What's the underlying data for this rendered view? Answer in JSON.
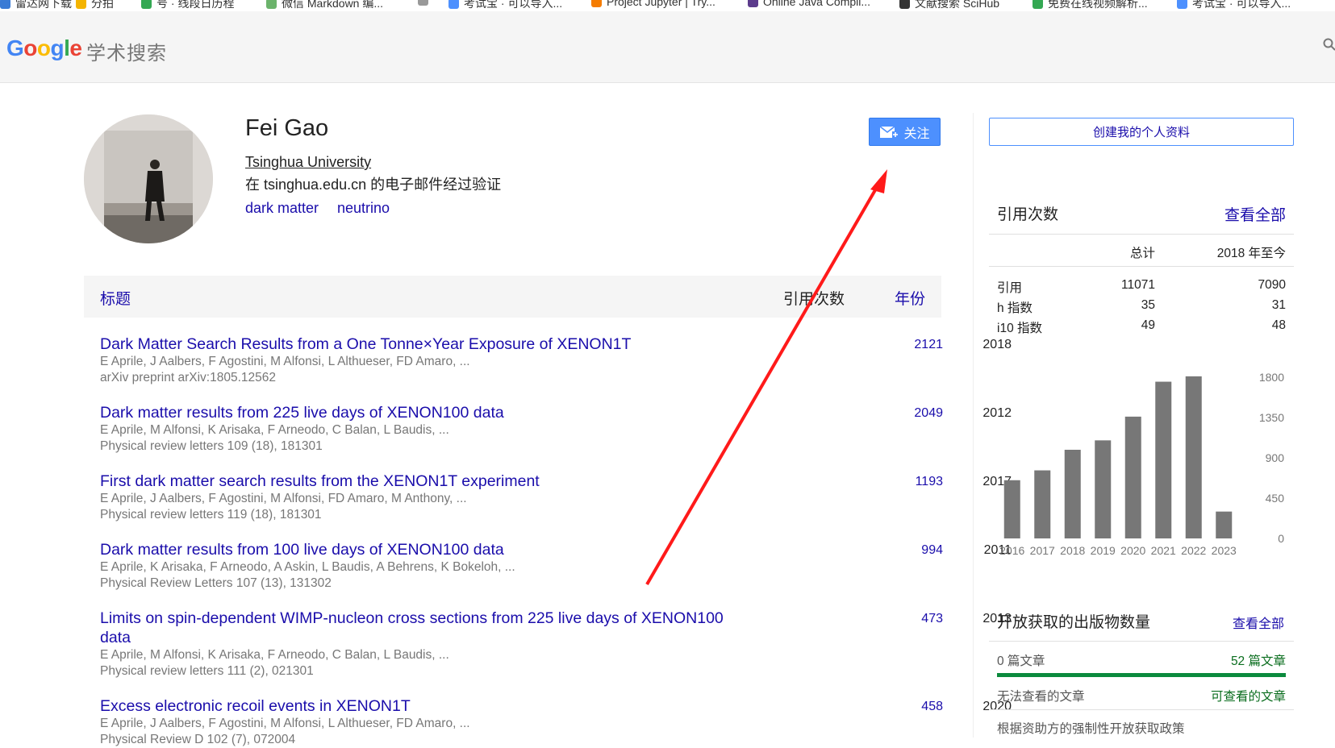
{
  "bookmarks": [
    {
      "label": "雷达网下载",
      "color": "#3a7bd5"
    },
    {
      "label": "分拍",
      "color": "#f4b400"
    },
    {
      "label": "号 · 线段日历程",
      "color": "#34a853"
    },
    {
      "label": "微信 Markdown 编...",
      "color": "#6bb36b"
    },
    {
      "label": "",
      "color": "#999999"
    },
    {
      "label": "考试宝 · 可以导入...",
      "color": "#4d90fe"
    },
    {
      "label": "Project Jupyter | Try...",
      "color": "#f57c00"
    },
    {
      "label": "Online Java Compil...",
      "color": "#5c3b8c"
    },
    {
      "label": "文献搜索 SciHub",
      "color": "#333333"
    },
    {
      "label": "免费在线视频解析...",
      "color": "#34a853"
    },
    {
      "label": "考试宝 · 可以导入...",
      "color": "#4d90fe"
    }
  ],
  "header": {
    "logo_letters": [
      {
        "ch": "G",
        "color": "#4285f4"
      },
      {
        "ch": "o",
        "color": "#ea4335"
      },
      {
        "ch": "o",
        "color": "#fbbc05"
      },
      {
        "ch": "g",
        "color": "#4285f4"
      },
      {
        "ch": "l",
        "color": "#34a853"
      },
      {
        "ch": "e",
        "color": "#ea4335"
      }
    ],
    "logo_subtitle": "学术搜索"
  },
  "profile": {
    "name": "Fei Gao",
    "affiliation": "Tsinghua University",
    "verified_email": "在 tsinghua.edu.cn 的电子邮件经过验证",
    "keywords": [
      "dark matter",
      "neutrino"
    ],
    "follow_label": "关注"
  },
  "table": {
    "col_title": "标题",
    "col_cites": "引用次数",
    "col_year": "年份",
    "rows": [
      {
        "title": "Dark Matter Search Results from a One Tonne×Year Exposure of XENON1T",
        "authors": "E Aprile, J Aalbers, F Agostini, M Alfonsi, L Althueser, FD Amaro, ...",
        "venue": "arXiv preprint arXiv:1805.12562",
        "cites": "2121",
        "year": "2018"
      },
      {
        "title": "Dark matter results from 225 live days of XENON100 data",
        "authors": "E Aprile, M Alfonsi, K Arisaka, F Arneodo, C Balan, L Baudis, ...",
        "venue": "Physical review letters 109 (18), 181301",
        "cites": "2049",
        "year": "2012"
      },
      {
        "title": "First dark matter search results from the XENON1T experiment",
        "authors": "E Aprile, J Aalbers, F Agostini, M Alfonsi, FD Amaro, M Anthony, ...",
        "venue": "Physical review letters 119 (18), 181301",
        "cites": "1193",
        "year": "2017"
      },
      {
        "title": "Dark matter results from 100 live days of XENON100 data",
        "authors": "E Aprile, K Arisaka, F Arneodo, A Askin, L Baudis, A Behrens, K Bokeloh, ...",
        "venue": "Physical Review Letters 107 (13), 131302",
        "cites": "994",
        "year": "2011"
      },
      {
        "title": "Limits on spin-dependent WIMP-nucleon cross sections from 225 live days of XENON100 data",
        "authors": "E Aprile, M Alfonsi, K Arisaka, F Arneodo, C Balan, L Baudis, ...",
        "venue": "Physical review letters 111 (2), 021301",
        "cites": "473",
        "year": "2013"
      },
      {
        "title": "Excess electronic recoil events in XENON1T",
        "authors": "E Aprile, J Aalbers, F Agostini, M Alfonsi, L Althueser, FD Amaro, ...",
        "venue": "Physical Review D 102 (7), 072004",
        "cites": "458",
        "year": "2020"
      }
    ]
  },
  "sidebar": {
    "create_profile": "创建我的个人资料",
    "cited_by": {
      "title": "引用次数",
      "view_all": "查看全部",
      "col_all": "总计",
      "col_since": "2018 年至今",
      "stats": [
        {
          "label": "引用",
          "all": "11071",
          "since": "7090"
        },
        {
          "label": "h 指数",
          "all": "35",
          "since": "31"
        },
        {
          "label": "i10 指数",
          "all": "49",
          "since": "48"
        }
      ]
    },
    "open_access": {
      "title": "开放获取的出版物数量",
      "view_all": "查看全部",
      "not_available": "0 篇文章",
      "available": "52 篇文章",
      "not_available_label": "无法查看的文章",
      "available_label": "可查看的文章",
      "mandate": "根据资助方的强制性开放获取政策"
    }
  },
  "chart_data": {
    "type": "bar",
    "categories": [
      "2016",
      "2017",
      "2018",
      "2019",
      "2020",
      "2021",
      "2022",
      "2023"
    ],
    "values": [
      650,
      760,
      990,
      1095,
      1360,
      1750,
      1810,
      300
    ],
    "ylim": [
      0,
      1800
    ],
    "yticks": [
      "1800",
      "1350",
      "900",
      "450",
      "0"
    ],
    "bar_color": "#777777",
    "grid": false
  },
  "annotation": {
    "color": "#ff1a1a"
  }
}
